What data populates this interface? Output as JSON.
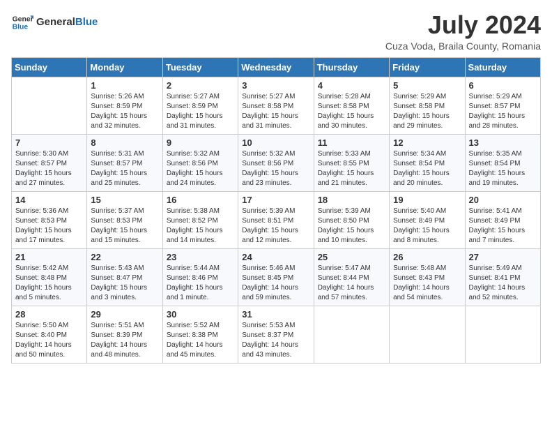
{
  "header": {
    "logo_general": "General",
    "logo_blue": "Blue",
    "month_year": "July 2024",
    "location": "Cuza Voda, Braila County, Romania"
  },
  "days_of_week": [
    "Sunday",
    "Monday",
    "Tuesday",
    "Wednesday",
    "Thursday",
    "Friday",
    "Saturday"
  ],
  "weeks": [
    [
      {
        "day": "",
        "info": ""
      },
      {
        "day": "1",
        "info": "Sunrise: 5:26 AM\nSunset: 8:59 PM\nDaylight: 15 hours\nand 32 minutes."
      },
      {
        "day": "2",
        "info": "Sunrise: 5:27 AM\nSunset: 8:59 PM\nDaylight: 15 hours\nand 31 minutes."
      },
      {
        "day": "3",
        "info": "Sunrise: 5:27 AM\nSunset: 8:58 PM\nDaylight: 15 hours\nand 31 minutes."
      },
      {
        "day": "4",
        "info": "Sunrise: 5:28 AM\nSunset: 8:58 PM\nDaylight: 15 hours\nand 30 minutes."
      },
      {
        "day": "5",
        "info": "Sunrise: 5:29 AM\nSunset: 8:58 PM\nDaylight: 15 hours\nand 29 minutes."
      },
      {
        "day": "6",
        "info": "Sunrise: 5:29 AM\nSunset: 8:57 PM\nDaylight: 15 hours\nand 28 minutes."
      }
    ],
    [
      {
        "day": "7",
        "info": "Sunrise: 5:30 AM\nSunset: 8:57 PM\nDaylight: 15 hours\nand 27 minutes."
      },
      {
        "day": "8",
        "info": "Sunrise: 5:31 AM\nSunset: 8:57 PM\nDaylight: 15 hours\nand 25 minutes."
      },
      {
        "day": "9",
        "info": "Sunrise: 5:32 AM\nSunset: 8:56 PM\nDaylight: 15 hours\nand 24 minutes."
      },
      {
        "day": "10",
        "info": "Sunrise: 5:32 AM\nSunset: 8:56 PM\nDaylight: 15 hours\nand 23 minutes."
      },
      {
        "day": "11",
        "info": "Sunrise: 5:33 AM\nSunset: 8:55 PM\nDaylight: 15 hours\nand 21 minutes."
      },
      {
        "day": "12",
        "info": "Sunrise: 5:34 AM\nSunset: 8:54 PM\nDaylight: 15 hours\nand 20 minutes."
      },
      {
        "day": "13",
        "info": "Sunrise: 5:35 AM\nSunset: 8:54 PM\nDaylight: 15 hours\nand 19 minutes."
      }
    ],
    [
      {
        "day": "14",
        "info": "Sunrise: 5:36 AM\nSunset: 8:53 PM\nDaylight: 15 hours\nand 17 minutes."
      },
      {
        "day": "15",
        "info": "Sunrise: 5:37 AM\nSunset: 8:53 PM\nDaylight: 15 hours\nand 15 minutes."
      },
      {
        "day": "16",
        "info": "Sunrise: 5:38 AM\nSunset: 8:52 PM\nDaylight: 15 hours\nand 14 minutes."
      },
      {
        "day": "17",
        "info": "Sunrise: 5:39 AM\nSunset: 8:51 PM\nDaylight: 15 hours\nand 12 minutes."
      },
      {
        "day": "18",
        "info": "Sunrise: 5:39 AM\nSunset: 8:50 PM\nDaylight: 15 hours\nand 10 minutes."
      },
      {
        "day": "19",
        "info": "Sunrise: 5:40 AM\nSunset: 8:49 PM\nDaylight: 15 hours\nand 8 minutes."
      },
      {
        "day": "20",
        "info": "Sunrise: 5:41 AM\nSunset: 8:49 PM\nDaylight: 15 hours\nand 7 minutes."
      }
    ],
    [
      {
        "day": "21",
        "info": "Sunrise: 5:42 AM\nSunset: 8:48 PM\nDaylight: 15 hours\nand 5 minutes."
      },
      {
        "day": "22",
        "info": "Sunrise: 5:43 AM\nSunset: 8:47 PM\nDaylight: 15 hours\nand 3 minutes."
      },
      {
        "day": "23",
        "info": "Sunrise: 5:44 AM\nSunset: 8:46 PM\nDaylight: 15 hours\nand 1 minute."
      },
      {
        "day": "24",
        "info": "Sunrise: 5:46 AM\nSunset: 8:45 PM\nDaylight: 14 hours\nand 59 minutes."
      },
      {
        "day": "25",
        "info": "Sunrise: 5:47 AM\nSunset: 8:44 PM\nDaylight: 14 hours\nand 57 minutes."
      },
      {
        "day": "26",
        "info": "Sunrise: 5:48 AM\nSunset: 8:43 PM\nDaylight: 14 hours\nand 54 minutes."
      },
      {
        "day": "27",
        "info": "Sunrise: 5:49 AM\nSunset: 8:41 PM\nDaylight: 14 hours\nand 52 minutes."
      }
    ],
    [
      {
        "day": "28",
        "info": "Sunrise: 5:50 AM\nSunset: 8:40 PM\nDaylight: 14 hours\nand 50 minutes."
      },
      {
        "day": "29",
        "info": "Sunrise: 5:51 AM\nSunset: 8:39 PM\nDaylight: 14 hours\nand 48 minutes."
      },
      {
        "day": "30",
        "info": "Sunrise: 5:52 AM\nSunset: 8:38 PM\nDaylight: 14 hours\nand 45 minutes."
      },
      {
        "day": "31",
        "info": "Sunrise: 5:53 AM\nSunset: 8:37 PM\nDaylight: 14 hours\nand 43 minutes."
      },
      {
        "day": "",
        "info": ""
      },
      {
        "day": "",
        "info": ""
      },
      {
        "day": "",
        "info": ""
      }
    ]
  ]
}
